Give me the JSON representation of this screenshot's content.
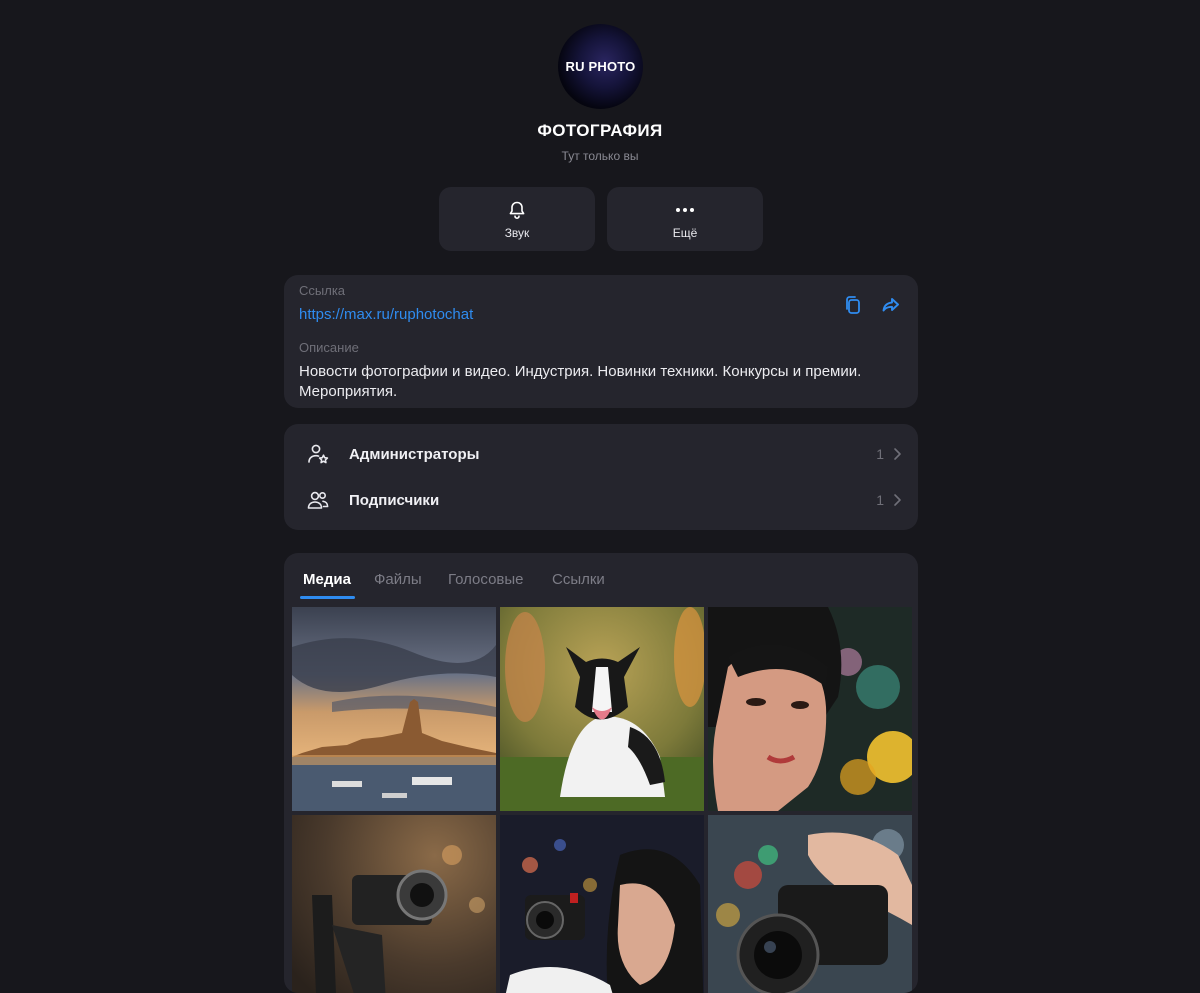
{
  "channel": {
    "avatar_text": "RU PHOTO",
    "title": "ФОТОГРАФИЯ",
    "subtitle": "Тут только вы"
  },
  "actions": [
    {
      "label": "Звук",
      "icon": "bell-icon"
    },
    {
      "label": "Ещё",
      "icon": "more-dots-icon"
    }
  ],
  "info": {
    "link_label": "Ссылка",
    "link_value": "https://max.ru/ruphotochat",
    "description_label": "Описание",
    "description_value": "Новости фотографии и видео. Индустрия. Новинки техники. Конкурсы и премии. Мероприятия.",
    "copy_icon": "copy-icon",
    "share_icon": "share-icon"
  },
  "members": [
    {
      "label": "Администраторы",
      "count": "1",
      "icon": "admin-user-star-icon"
    },
    {
      "label": "Подписчики",
      "count": "1",
      "icon": "users-icon"
    }
  ],
  "media": {
    "tabs": [
      "Медиа",
      "Файлы",
      "Голосовые",
      "Ссылки"
    ],
    "active_tab": "Медиа",
    "thumbnails": [
      "town-at-sunset-photo",
      "border-collie-dog-photo",
      "woman-portrait-bokeh-photo",
      "camera-on-gimbal-photo",
      "woman-with-camera-photo",
      "hands-holding-camera-photo"
    ]
  },
  "colors": {
    "background": "#17171c",
    "card": "#25252d",
    "accent": "#2f8cf0",
    "muted_text": "#6f6f78"
  }
}
